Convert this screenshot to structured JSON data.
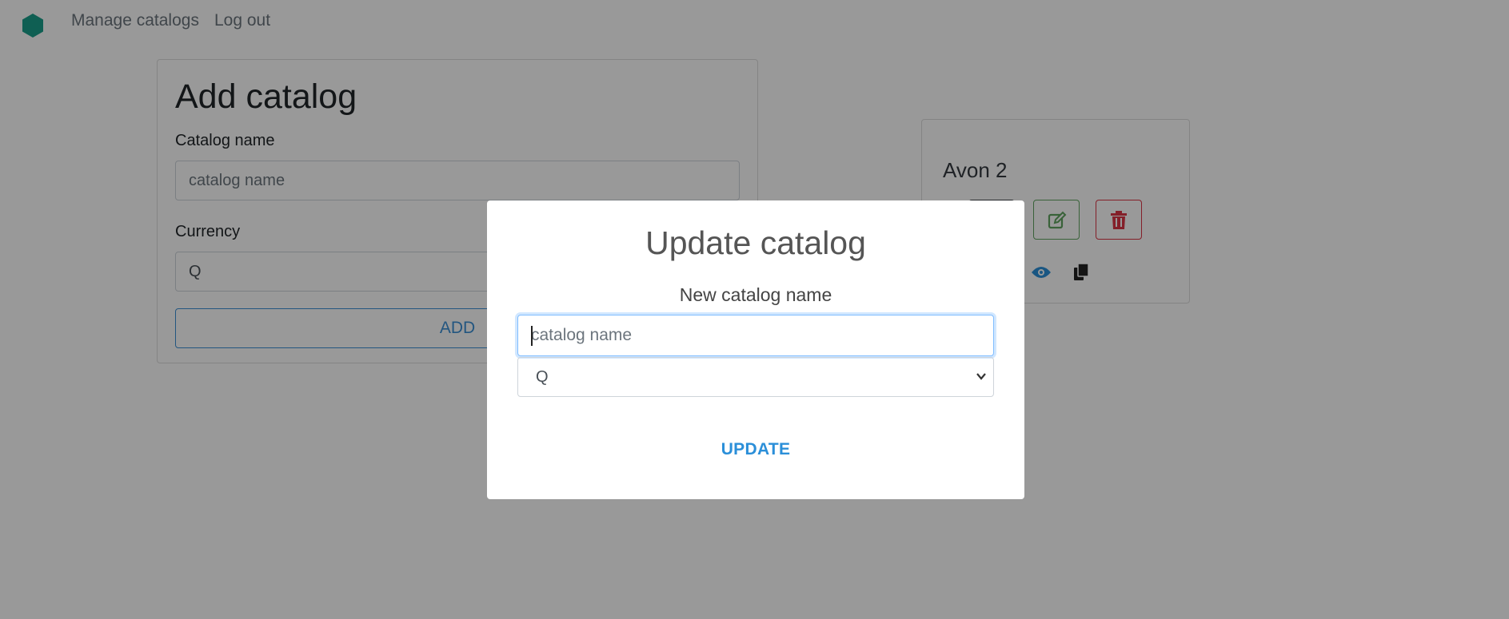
{
  "navbar": {
    "logo_icon": "hexagon-logo",
    "links": [
      {
        "label": "Manage catalogs"
      },
      {
        "label": "Log out"
      }
    ]
  },
  "add_catalog": {
    "title": "Add catalog",
    "name_label": "Catalog name",
    "name_placeholder": "catalog name",
    "currency_label": "Currency",
    "currency_value": "Q",
    "add_label": "ADD"
  },
  "catalog_card": {
    "name": "Avon 2",
    "actions": [
      "view-icon",
      "edit-icon",
      "trash-icon",
      "eye-icon",
      "copy-icon"
    ],
    "colors": {
      "edit": "#5fa35f",
      "delete": "#dc3545",
      "view": "#2b8fd9"
    }
  },
  "modal": {
    "title": "Update catalog",
    "name_label": "New catalog name",
    "name_placeholder": "catalog name",
    "currency_value": "Q",
    "update_label": "UPDATE"
  },
  "colors": {
    "accent": "#2b8fd9",
    "logo": "#1a9e8a"
  }
}
